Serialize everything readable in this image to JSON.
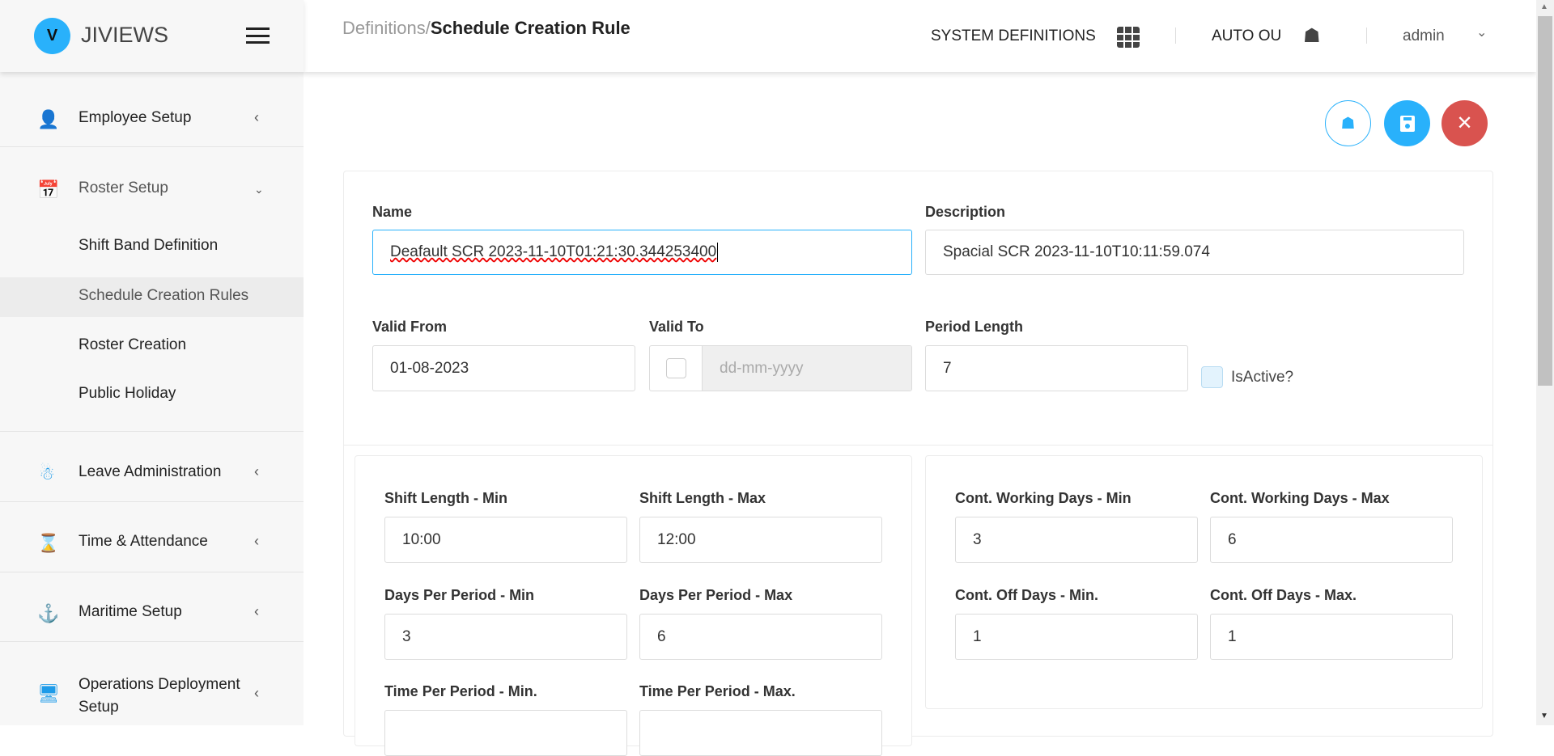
{
  "brand": {
    "name": "JIVIEWS"
  },
  "sidebar": {
    "items": [
      {
        "label": "Employee Setup",
        "icon": "employee-icon"
      },
      {
        "label": "Roster Setup",
        "icon": "calendar-icon"
      },
      {
        "label": "Leave Administration",
        "icon": "snowman-icon"
      },
      {
        "label": "Time & Attendance",
        "icon": "hourglass-icon"
      },
      {
        "label": "Maritime Setup",
        "icon": "anchor-icon"
      },
      {
        "label": "Operations Deployment Setup",
        "icon": "deployment-icon"
      }
    ],
    "roster_subitems": [
      "Shift Band Definition",
      "Schedule Creation Rules",
      "Roster Creation",
      "Public Holiday"
    ],
    "active_subitem": "Schedule Creation Rules"
  },
  "header": {
    "breadcrumb_parent": "Definitions/",
    "breadcrumb_current": "Schedule Creation Rule",
    "system_definitions": "SYSTEM DEFINITIONS",
    "auto_ou": "AUTO OU",
    "user": "admin"
  },
  "colors": {
    "accent": "#29b1fb",
    "danger": "#d9534f"
  },
  "form": {
    "name_label": "Name",
    "name_value": "Deafault SCR 2023-11-10T01:21:30.344253400",
    "description_label": "Description",
    "description_value": "Spacial SCR 2023-11-10T10:11:59.074",
    "valid_from_label": "Valid From",
    "valid_from_value": "01-08-2023",
    "valid_to_label": "Valid To",
    "valid_to_placeholder": "dd-mm-yyyy",
    "period_length_label": "Period Length",
    "period_length_value": "7",
    "is_active_label": "IsActive?"
  },
  "left_rules": [
    {
      "label": "Shift Length - Min",
      "value": "10:00"
    },
    {
      "label": "Shift Length - Max",
      "value": "12:00"
    },
    {
      "label": "Days Per Period - Min",
      "value": "3"
    },
    {
      "label": "Days Per Period - Max",
      "value": "6"
    },
    {
      "label": "Time Per Period - Min.",
      "value": ""
    },
    {
      "label": "Time Per Period - Max.",
      "value": ""
    }
  ],
  "right_rules": [
    {
      "label": "Cont. Working Days - Min",
      "value": "3"
    },
    {
      "label": "Cont. Working Days - Max",
      "value": "6"
    },
    {
      "label": "Cont. Off Days - Min.",
      "value": "1"
    },
    {
      "label": "Cont. Off Days - Max.",
      "value": "1"
    }
  ]
}
